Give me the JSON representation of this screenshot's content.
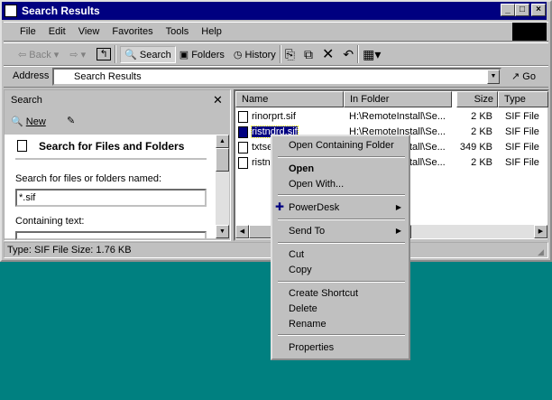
{
  "window": {
    "title": "Search Results"
  },
  "menu": [
    "File",
    "Edit",
    "View",
    "Favorites",
    "Tools",
    "Help"
  ],
  "toolbar": {
    "back": "Back",
    "search": "Search",
    "folders": "Folders",
    "history": "History"
  },
  "address": {
    "label": "Address",
    "value": "Search Results",
    "go": "Go"
  },
  "search_pane": {
    "title": "Search",
    "new": "New",
    "heading": "Search for Files and Folders",
    "named_label": "Search for files or folders named:",
    "named_value": "*.sif",
    "containing_label": "Containing text:"
  },
  "columns": [
    "Name",
    "In Folder",
    "Size",
    "Type"
  ],
  "files": [
    {
      "name": "rinorprt.sif",
      "folder": "H:\\RemoteInstall\\Se...",
      "size": "2 KB",
      "type": "SIF File"
    },
    {
      "name": "ristndrd.sif",
      "folder": "H:\\RemoteInstall\\Se...",
      "size": "2 KB",
      "type": "SIF File"
    },
    {
      "name": "txtse",
      "folder": "tall\\Se...",
      "size": "349 KB",
      "type": "SIF File"
    },
    {
      "name": "ristn",
      "folder": "tall\\Se...",
      "size": "2 KB",
      "type": "SIF File"
    }
  ],
  "status": "Type: SIF File Size: 1.76 KB",
  "context_menu": [
    "Open Containing Folder",
    "Open",
    "Open With...",
    "PowerDesk",
    "Send To",
    "Cut",
    "Copy",
    "Create Shortcut",
    "Delete",
    "Rename",
    "Properties"
  ],
  "colors": {
    "titlebar": "#000080",
    "desktop": "#008080",
    "selection": "#000080"
  }
}
